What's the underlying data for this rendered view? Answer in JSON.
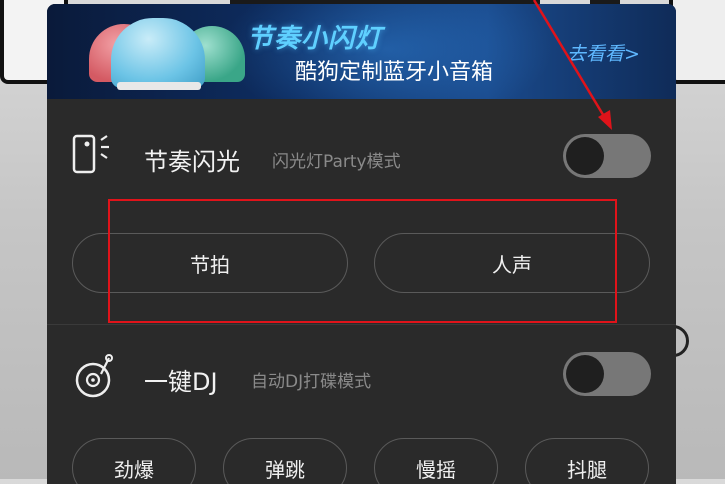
{
  "banner": {
    "title": "节奏小闪灯",
    "subtitle": "酷狗定制蓝牙小音箱",
    "link": "去看看>"
  },
  "rhythm_flash": {
    "title": "节奏闪光",
    "subtitle": "闪光灯Party模式",
    "toggle_on": false,
    "icon": "phone-flash-icon",
    "modes": [
      "节拍",
      "人声"
    ]
  },
  "one_key_dj": {
    "title": "一键DJ",
    "subtitle": "自动DJ打碟模式",
    "toggle_on": false,
    "icon": "turntable-icon",
    "modes": [
      "劲爆",
      "弹跳",
      "慢摇",
      "抖腿"
    ]
  },
  "annotation_color": "#e0131a"
}
